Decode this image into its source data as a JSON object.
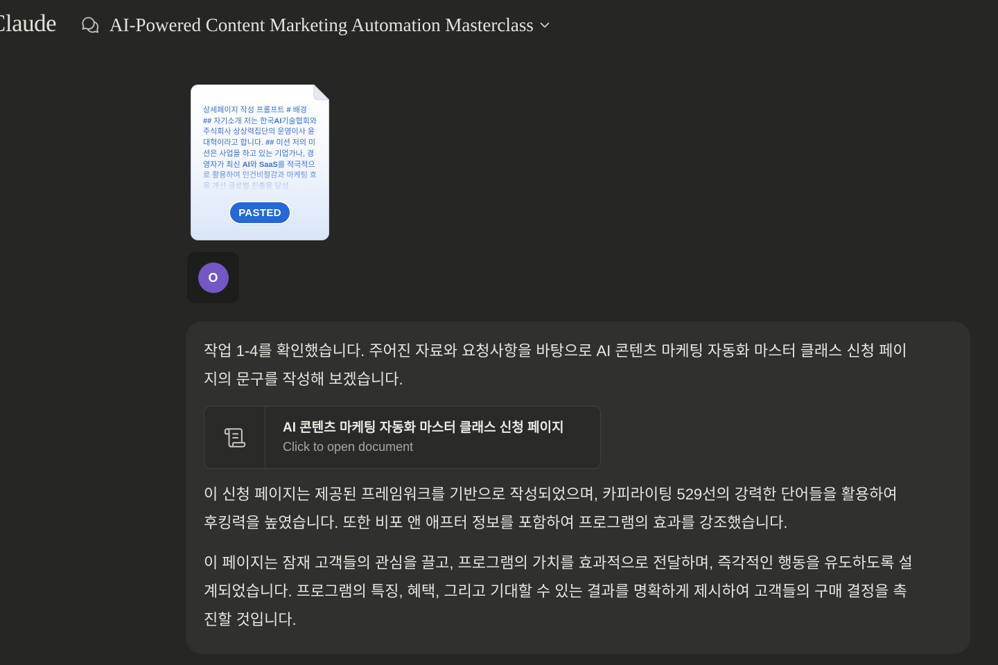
{
  "app": {
    "logo_text": "Claude"
  },
  "header": {
    "chat_icon": "chat-bubbles-icon",
    "conversation_title": "AI-Powered Content Marketing Automation Masterclass",
    "dropdown_icon": "chevron-down-icon"
  },
  "user_message": {
    "pasted_attachment": {
      "preview_segments": [
        "상세페이지 작성 프롬프트 ",
        "#",
        " 배경 ",
        "##",
        " 자기소개 저는 한국",
        "AI",
        "기술협회와 주식회사 상상력집단의 운영이사 윤대혁이라고 합니다. ",
        "##",
        " 미션 저의 미션은 사업을 하고 있는 기업가나, 경영자가 최신 ",
        "AI",
        "와 ",
        "SaaS",
        "를 적극적으로 활용하여 인건비절감과 마케팅 효율 개선 글로벌 진출을 달성"
      ],
      "badge_label": "PASTED"
    },
    "avatar": {
      "initial": "O"
    }
  },
  "assistant_message": {
    "paragraphs": [
      "작업 1-4를 확인했습니다. 주어진 자료와 요청사항을 바탕으로 AI 콘텐츠 마케팅 자동화 마스터 클래스 신청 페이지의 문구를 작성해 보겠습니다.",
      "이 신청 페이지는 제공된 프레임워크를 기반으로 작성되었으며, 카피라이팅 529선의 강력한 단어들을 활용하여 후킹력을 높였습니다. 또한 비포 앤 애프터 정보를 포함하여 프로그램의 효과를 강조했습니다.",
      "이 페이지는 잠재 고객들의 관심을 끌고, 프로그램의 가치를 효과적으로 전달하며, 즉각적인 행동을 유도하도록 설계되었습니다. 프로그램의 특징, 혜택, 그리고 기대할 수 있는 결과를 명확하게 제시하여 고객들의 구매 결정을 촉진할 것입니다."
    ],
    "artifact": {
      "icon": "document-scroll-icon",
      "title": "AI 콘텐츠 마케팅 자동화 마스터 클래스 신청 페이지",
      "subtitle": "Click to open document"
    }
  },
  "colors": {
    "page_background": "#262624",
    "message_background": "#30302e",
    "text_primary": "#e8e5dd",
    "text_secondary": "#a9a69e",
    "pasted_text": "#3a73d0",
    "pasted_badge": "#2468d9",
    "avatar": "#7357c4"
  }
}
